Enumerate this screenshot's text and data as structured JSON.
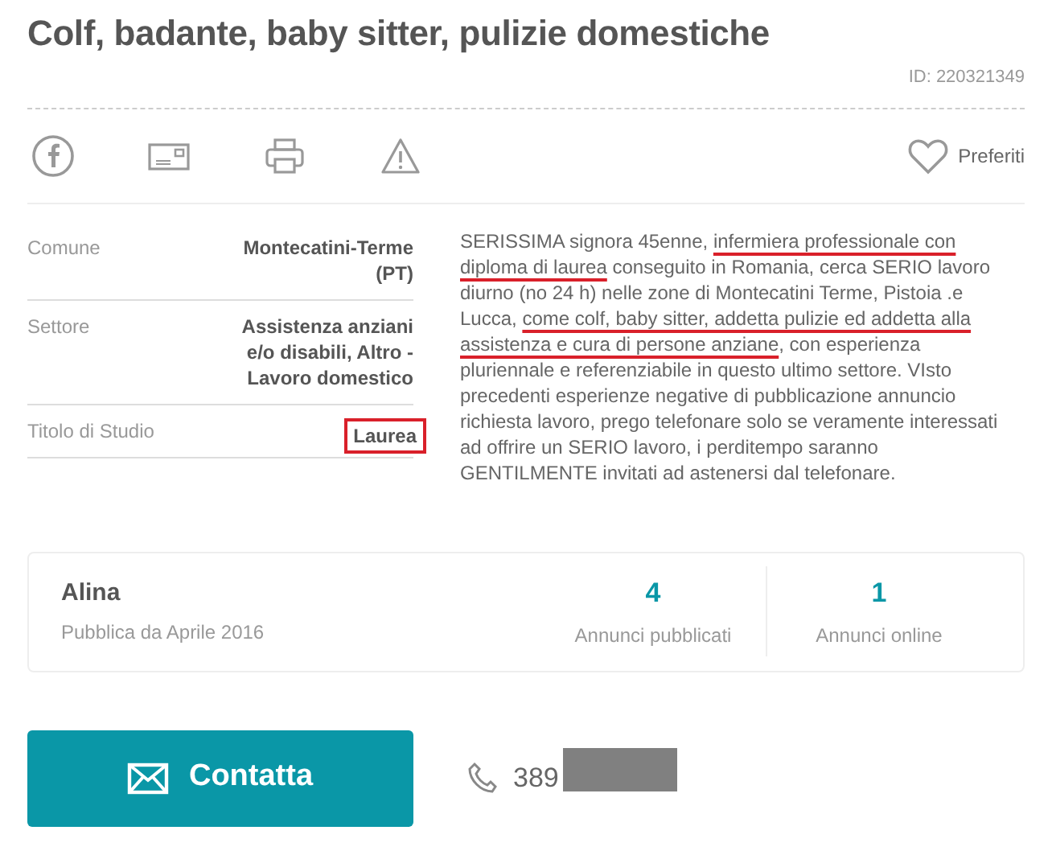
{
  "title": "Colf, badante, baby sitter, pulizie domestiche",
  "ad_id": "ID: 220321349",
  "share_icons": [
    {
      "kind": "facebook"
    },
    {
      "kind": "card"
    },
    {
      "kind": "print"
    },
    {
      "kind": "warning"
    }
  ],
  "favorite": {
    "label": "Preferiti",
    "selected": false
  },
  "details": [
    {
      "label": "Comune",
      "value": "Montecatini-Terme (PT)",
      "highlighted": false
    },
    {
      "label": "Settore",
      "value": "Assistenza anziani e/o disabili, Altro - Lavoro domestico",
      "highlighted": false
    },
    {
      "label": "Titolo di Studio",
      "value": "Laurea",
      "highlighted": true
    }
  ],
  "description": [
    {
      "text": "SERISSIMA signora 45enne, ",
      "underlined": false
    },
    {
      "text": "infermiera professionale con diploma di laurea",
      "underlined": true
    },
    {
      "text": " conseguito in Romania, cerca SERIO lavoro diurno (no 24 h) nelle zone di Montecatini Terme, Pistoia .e Lucca, ",
      "underlined": false
    },
    {
      "text": "come colf, baby sitter, addetta pulizie ed addetta alla assistenza e cura di persone anziane",
      "underlined": true
    },
    {
      "text": ", con esperienza pluriennale e referenziabile in questo ultimo settore. VIsto precedenti esperienze negative di pubblicazione annuncio richiesta lavoro, prego telefonare solo se veramente interessati ad offrire un SERIO lavoro, i perditempo saranno GENTILMENTE invitati ad astenersi dal telefonare.",
      "underlined": false
    }
  ],
  "advertiser": {
    "name": "Alina",
    "since": "Pubblica da Aprile 2016",
    "stats": [
      {
        "value": "4",
        "label": "Annunci pubblicati"
      },
      {
        "value": "1",
        "label": "Annunci online"
      }
    ]
  },
  "contact_button": "Contatta",
  "phone": {
    "number": "389",
    "redacted": true
  }
}
